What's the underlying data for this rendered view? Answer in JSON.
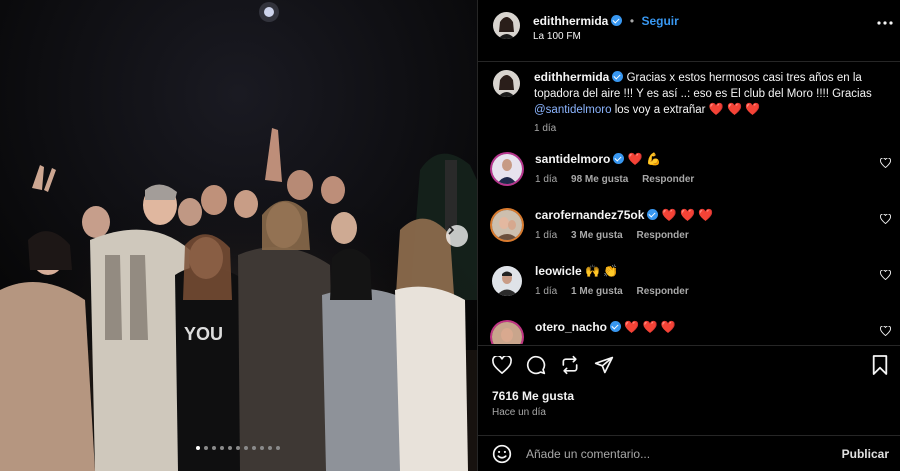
{
  "post": {
    "author": "edithhermida",
    "follow_label": "Seguir",
    "dot": "•",
    "location": "La 100 FM",
    "caption_author": "edithhermida",
    "caption_line1": "Gracias x estos hermosos casi tres años en la",
    "caption_line2": "topadora del aire !!! Y es así ..: eso es El club del Moro !!!! Gracias",
    "caption_mention": "@santidelmoro",
    "caption_tail": " los voy a extrañar",
    "caption_hearts": "❤️ ❤️ ❤️",
    "caption_time": "1 día",
    "likes": "7616 Me gusta",
    "posted_ago": "Hace un día"
  },
  "comments": [
    {
      "user": "santidelmoro",
      "verified": true,
      "text": "❤️ 💪",
      "time": "1 día",
      "likes": "98 Me gusta",
      "reply": "Responder"
    },
    {
      "user": "carofernandez75ok",
      "verified": true,
      "text": "❤️ ❤️ ❤️",
      "time": "1 día",
      "likes": "3 Me gusta",
      "reply": "Responder"
    },
    {
      "user": "leowicle",
      "verified": false,
      "text": "🙌 👏",
      "time": "1 día",
      "likes": "1 Me gusta",
      "reply": "Responder"
    },
    {
      "user": "otero_nacho",
      "verified": true,
      "text": "❤️ ❤️ ❤️",
      "time": "",
      "likes": "",
      "reply": ""
    }
  ],
  "composer": {
    "placeholder": "Añade un comentario...",
    "publish_label": "Publicar"
  },
  "carousel": {
    "slide_count": 11,
    "active_index": 0
  },
  "colors": {
    "accent": "#3897f0",
    "heart": "#ed4956",
    "background": "#000000"
  },
  "icons": [
    "more-icon",
    "heart-icon",
    "comment-icon",
    "share-icon",
    "send-icon",
    "bookmark-icon",
    "emoji-icon",
    "next-icon"
  ]
}
